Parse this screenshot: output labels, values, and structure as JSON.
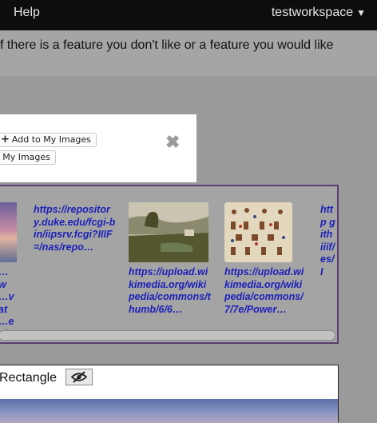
{
  "topbar": {
    "help": "Help",
    "workspace": "testworkspace"
  },
  "notice": {
    "text": "f there is a feature you don't like or a feature you would like"
  },
  "panel": {
    "add_button": "Add to My Images",
    "add_button_icon": "plus-icon",
    "second_button": "o My Images",
    "close_icon": "close-icon"
  },
  "gallery": {
    "items": [
      {
        "caption": "…w …vat …es/ …–…"
      },
      {
        "caption": "https://repository.duke.edu/fcgi-bin/iipsrv.fcgi?IIIF=/nas/repo…"
      },
      {
        "caption": "https://upload.wikimedia.org/wikipedia/commons/thumb/6/6…"
      },
      {
        "caption": "https://upload.wikimedia.org/wikipedia/commons/7/7e/Power…"
      },
      {
        "caption": "http gith iiif/ es/I"
      }
    ],
    "accent": "#5a3d70",
    "link_color": "#1a1fb8"
  },
  "rect_panel": {
    "label": "Rectangle",
    "visibility_icon": "eye-off-icon"
  }
}
